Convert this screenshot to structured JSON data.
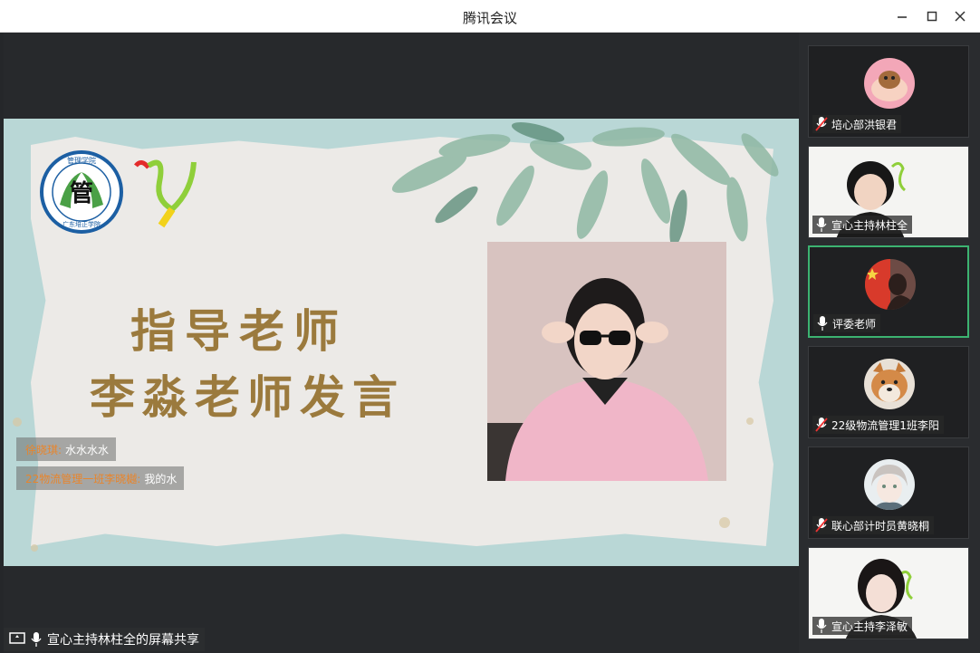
{
  "window": {
    "title": "腾讯会议"
  },
  "slide": {
    "heading_line1": "指导老师",
    "heading_line2": "李淼老师发言",
    "logo_text_top": "管理学院",
    "logo_text_bottom": "广东培正学院",
    "logo_center": "管"
  },
  "chat": [
    {
      "sender": "徐晓琪:",
      "message": "水水水水"
    },
    {
      "sender": "22物流管理一班李晓樾:",
      "message": "我的水"
    }
  ],
  "share": {
    "label": "宣心主持林柱全的屏幕共享"
  },
  "participants": [
    {
      "name": "培心部洪银君",
      "mic": "muted",
      "type": "avatar",
      "avatar": "cake-avatar"
    },
    {
      "name": "宣心主持林柱全",
      "mic": "on",
      "type": "video",
      "avatar": "camera-boy"
    },
    {
      "name": "评委老师",
      "mic": "on",
      "type": "avatar",
      "avatar": "flag-avatar",
      "active": true
    },
    {
      "name": "22级物流管理1班李阳",
      "mic": "muted",
      "type": "avatar",
      "avatar": "dog-avatar"
    },
    {
      "name": "联心部计时员黄晓桐",
      "mic": "muted",
      "type": "avatar",
      "avatar": "anime-avatar"
    },
    {
      "name": "宣心主持李泽敏",
      "mic": "on",
      "type": "video",
      "avatar": "camera-girl"
    }
  ],
  "colors": {
    "heading": "#9b7a3d",
    "chat_sender": "#e8852c",
    "active_border": "#3cb371"
  }
}
